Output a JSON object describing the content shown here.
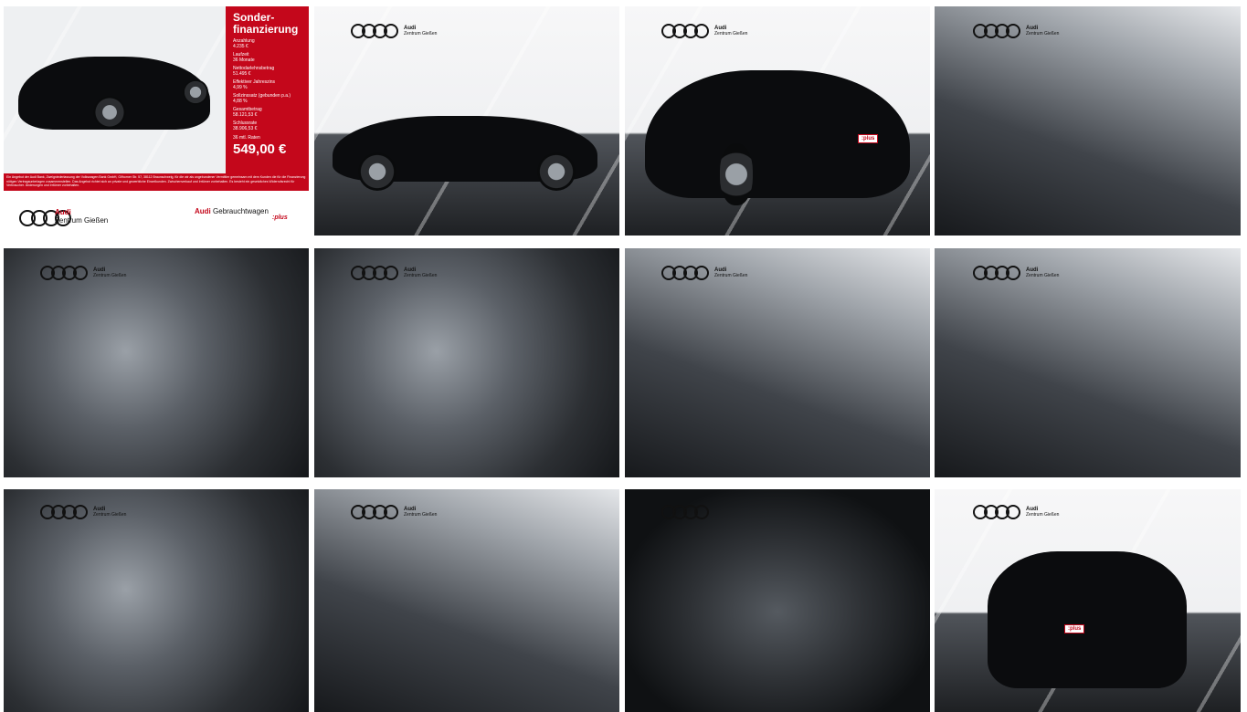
{
  "brand": {
    "dealer_brand": "Audi",
    "dealer_name": "Zentrum Gießen",
    "program_brand": "Audi",
    "program_name": "Gebrauchtwagen",
    "program_suffix": ":plus"
  },
  "offer": {
    "title": "Sonder-finanzierung",
    "items": [
      {
        "label": "Anzahlung",
        "value": "4.235 €"
      },
      {
        "label": "Laufzeit",
        "value": "36 Monate"
      },
      {
        "label": "Nettodarlehnsbetrag",
        "value": "51.495 €"
      },
      {
        "label": "Effektiver Jahreszins",
        "value": "4,99 %"
      },
      {
        "label": "Sollzinssatz (gebunden p.a.)",
        "value": "4,88 %"
      },
      {
        "label": "Gesamtbetrag",
        "value": "58.121,53 €"
      },
      {
        "label": "Schlussrate",
        "value": "38.906,53 €"
      }
    ],
    "rate_label": "36 mtl. Raten",
    "rate_price": "549,00 €",
    "disclaimer": "Ein Angebot der Audi Bank, Zweigniederlassung der Volkswagen Bank GmbH, Gifhorner Str. 57, 38112 Braunschweig, für die wir als ungebundener Vermittler gemeinsam mit dem Kunden die für die Finanzierung nötigen Vertragsunterlagen zusammenstellen. Das Angebot richtet sich an private und gewerbliche Einzelkunden. Zwischenverkauf und Irrtümer vorbehalten. Es besteht ein gesetzliches Widerrufsrecht für Verbraucher. Änderungen und Irrtümer vorbehalten."
  },
  "plate_text": ":plus",
  "gallery": {
    "photos": [
      {
        "name": "photo-front-offer"
      },
      {
        "name": "photo-side"
      },
      {
        "name": "photo-rear-three-quarter"
      },
      {
        "name": "photo-front-seats"
      },
      {
        "name": "photo-door-panel"
      },
      {
        "name": "photo-rear-seats"
      },
      {
        "name": "photo-cockpit-left"
      },
      {
        "name": "photo-cockpit-center"
      },
      {
        "name": "photo-center-console"
      },
      {
        "name": "photo-dashboard"
      },
      {
        "name": "photo-trunk"
      },
      {
        "name": "photo-rear"
      }
    ]
  }
}
